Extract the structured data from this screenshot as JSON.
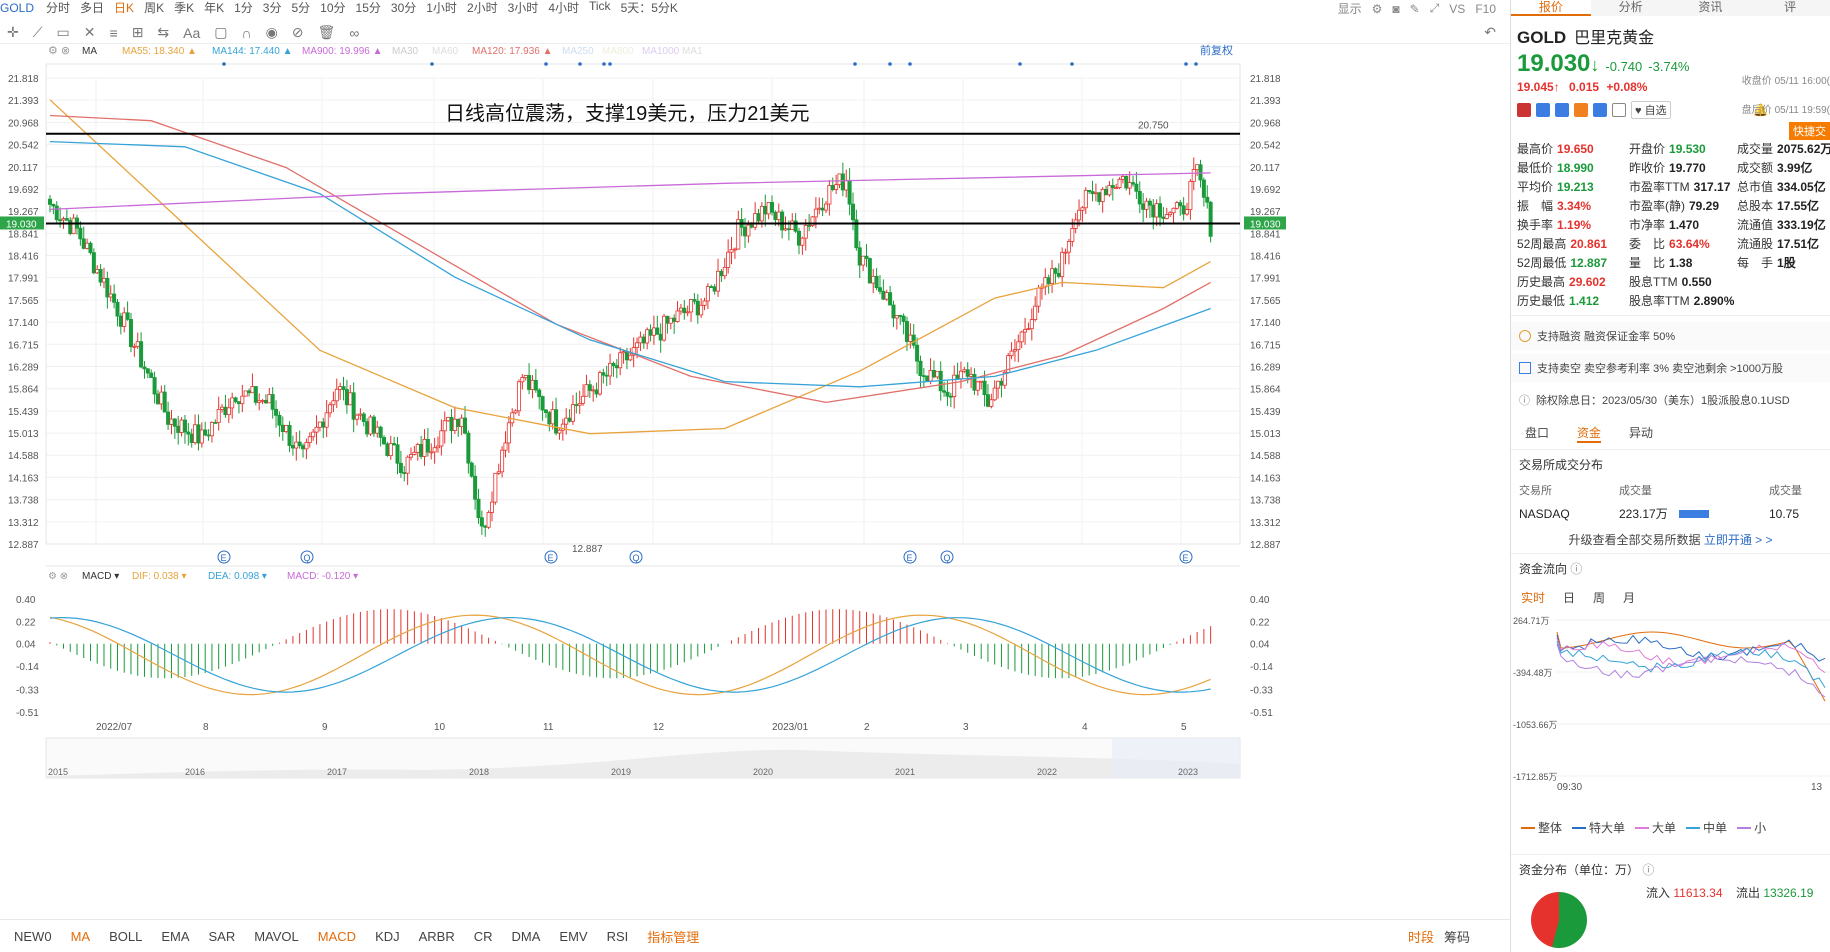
{
  "topbar": {
    "symbol": "GOLD",
    "periods": [
      "分时",
      "多日",
      "日K",
      "周K",
      "季K",
      "年K",
      "1分",
      "3分",
      "5分",
      "10分",
      "15分",
      "30分",
      "1小时",
      "2小时",
      "3小时",
      "4小时",
      "Tick",
      "5天：5分K"
    ],
    "active_period": "日K",
    "right_labels": {
      "display": "显示",
      "vs": "VS",
      "f10": "F10"
    }
  },
  "ma_legend": [
    {
      "label": "MA",
      "value": ""
    },
    {
      "label": "MA55:",
      "value": "18.340"
    },
    {
      "label": "MA144:",
      "value": "17.440"
    },
    {
      "label": "MA900:",
      "value": "19.996"
    },
    {
      "label": "MA30",
      "value": ""
    },
    {
      "label": "MA60",
      "value": ""
    },
    {
      "label": "MA120:",
      "value": "17.936"
    },
    {
      "label": "MA250",
      "value": ""
    },
    {
      "label": "MA800",
      "value": ""
    },
    {
      "label": "MA1000",
      "value": ""
    },
    {
      "label": "MA1",
      "value": ""
    }
  ],
  "adjust_label": "前复权",
  "annotation": "日线高位震荡，支撑19美元，压力21美元",
  "resistance_label": "20.750",
  "low_label": "12.887",
  "current_price_tag": "19.030",
  "price_axis": [
    "21.818",
    "21.393",
    "20.968",
    "20.542",
    "20.117",
    "19.692",
    "19.267",
    "18.841",
    "18.416",
    "17.991",
    "17.565",
    "17.140",
    "16.715",
    "16.289",
    "15.864",
    "15.439",
    "15.013",
    "14.588",
    "14.163",
    "13.738",
    "13.312",
    "12.887"
  ],
  "macd_legend": {
    "name": "MACD",
    "dif_label": "DIF:",
    "dif": "0.038",
    "dea_label": "DEA:",
    "dea": "0.098",
    "macd_label": "MACD:",
    "macd": "-0.120"
  },
  "macd_axis": [
    "0.40",
    "0.22",
    "0.04",
    "-0.14",
    "-0.33",
    "-0.51"
  ],
  "date_axis": [
    "2022/07",
    "8",
    "9",
    "10",
    "11",
    "12",
    "2023/01",
    "2",
    "3",
    "4",
    "5"
  ],
  "nav_years": [
    "2015",
    "2016",
    "2017",
    "2018",
    "2019",
    "2020",
    "2021",
    "2022",
    "2023"
  ],
  "event_markers": [
    "E",
    "Q",
    "E",
    "Q",
    "E",
    "Q",
    "E"
  ],
  "bottom_indicators": [
    "NEW0",
    "MA",
    "BOLL",
    "EMA",
    "SAR",
    "MAVOL",
    "MACD",
    "KDJ",
    "ARBR",
    "CR",
    "DMA",
    "EMV",
    "RSI"
  ],
  "active_indicators": [
    "MA",
    "MACD"
  ],
  "indicator_manager": "指标管理",
  "bottom_right": [
    "时段",
    "筹码"
  ],
  "panel": {
    "tabs": [
      "报价",
      "分析",
      "资讯",
      "评"
    ],
    "ticker": "GOLD",
    "name": "巴里克黄金",
    "price": "19.030",
    "arrow": "↓",
    "change": "-0.740",
    "change_pct": "-3.74%",
    "close_label": "收盘价 05/11 16:00(",
    "ah_price": "19.045↑",
    "ah_change": "0.015",
    "ah_pct": "+0.08%",
    "ah_label": "盘后价 05/11 19:59(",
    "watch": "自选",
    "quick": "快捷交",
    "stats": [
      [
        "最高价",
        "19.650",
        "red"
      ],
      [
        "开盘价",
        "19.530",
        "grn"
      ],
      [
        "成交量",
        "2075.62万",
        "blk"
      ],
      [
        "最低价",
        "18.990",
        "grn"
      ],
      [
        "昨收价",
        "19.770",
        "blk"
      ],
      [
        "成交额",
        "3.99亿",
        "blk"
      ],
      [
        "平均价",
        "19.213",
        "grn"
      ],
      [
        "市盈率TTM",
        "317.17",
        "blk"
      ],
      [
        "总市值",
        "334.05亿",
        "blk"
      ],
      [
        "振　幅",
        "3.34%",
        "red"
      ],
      [
        "市盈率(静)",
        "79.29",
        "blk"
      ],
      [
        "总股本",
        "17.55亿",
        "blk"
      ],
      [
        "换手率",
        "1.19%",
        "red"
      ],
      [
        "市净率",
        "1.470",
        "blk"
      ],
      [
        "流通值",
        "333.19亿",
        "blk"
      ],
      [
        "52周最高",
        "20.861",
        "red"
      ],
      [
        "委　比",
        "63.64%",
        "red"
      ],
      [
        "流通股",
        "17.51亿",
        "blk"
      ],
      [
        "52周最低",
        "12.887",
        "grn"
      ],
      [
        "量　比",
        "1.38",
        "blk"
      ],
      [
        "每　手",
        "1股",
        "blk"
      ],
      [
        "历史最高",
        "29.602",
        "red"
      ],
      [
        "股息TTM",
        "0.550",
        "blk"
      ],
      [
        "",
        "",
        " "
      ],
      [
        "历史最低",
        "1.412",
        "grn"
      ],
      [
        "股息率TTM",
        "2.890%",
        "blk"
      ],
      [
        "",
        "",
        " "
      ]
    ],
    "note1": "支持融资 融资保证金率 50%",
    "note2": "支持卖空 卖空参考利率 3% 卖空池剩余 >1000万股",
    "note3": "除权除息日：2023/05/30（美东）1股派股息0.1USD",
    "subtabs": [
      "盘口",
      "资金",
      "异动"
    ],
    "sub_active": "资金",
    "dist_title": "交易所成交分布",
    "dist_cols": [
      "交易所",
      "成交量",
      "成交量"
    ],
    "dist_row": {
      "exchange": "NASDAQ",
      "vol": "223.17万",
      "vol2": "10.75"
    },
    "upgrade": "升级查看全部交易所数据",
    "upgrade_link": "立即开通 > >",
    "flow_title": "资金流向",
    "flow_tabs": [
      "实时",
      "日",
      "周",
      "月"
    ],
    "flow_axis": [
      "264.71万",
      "-394.48万",
      "-1053.66万",
      "-1712.85万"
    ],
    "flow_time": [
      "09:30",
      "13"
    ],
    "flow_legend": [
      "整体",
      "特大单",
      "大单",
      "中单",
      "小"
    ],
    "dist2_title": "资金分布（单位：万）",
    "inflow_label": "流入",
    "inflow": "11613.34",
    "outflow_label": "流出",
    "outflow": "13326.19"
  },
  "colors": {
    "up": "#e5322d",
    "down": "#1a9a3a",
    "ma55": "#e8a33d",
    "ma144": "#35a3d9",
    "ma900": "#c86ad8",
    "ma120": "#e0706a",
    "accent": "#e36c0a"
  }
}
